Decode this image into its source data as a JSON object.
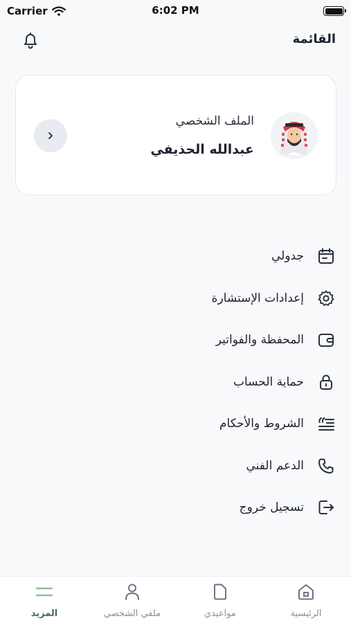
{
  "status_bar": {
    "carrier": "Carrier",
    "time": "6:02 PM"
  },
  "header": {
    "title": "القائمة"
  },
  "profile": {
    "label": "الملف الشخصي",
    "name": "عبدالله الحذيفي"
  },
  "menu": {
    "items": [
      {
        "label": "جدولي",
        "icon": "calendar-icon"
      },
      {
        "label": "إعدادات الإستشارة",
        "icon": "gear-icon"
      },
      {
        "label": "المحفظة والفواتير",
        "icon": "wallet-icon"
      },
      {
        "label": "حماية الحساب",
        "icon": "lock-icon"
      },
      {
        "label": "الشروط والأحكام",
        "icon": "terms-icon"
      },
      {
        "label": "الدعم الفني",
        "icon": "phone-icon"
      },
      {
        "label": "تسجيل خروج",
        "icon": "logout-icon"
      }
    ]
  },
  "bottom_nav": {
    "items": [
      {
        "label": "الرئيسية",
        "icon": "home-icon",
        "active": false
      },
      {
        "label": "مواعيدي",
        "icon": "document-icon",
        "active": false
      },
      {
        "label": "ملفي الشخصي",
        "icon": "person-icon",
        "active": false
      },
      {
        "label": "المزيد",
        "icon": "menu-icon",
        "active": true
      }
    ]
  },
  "colors": {
    "accent": "#3f6f4f",
    "icon": "#2b2f3d",
    "inactive": "#8a8f9c"
  }
}
